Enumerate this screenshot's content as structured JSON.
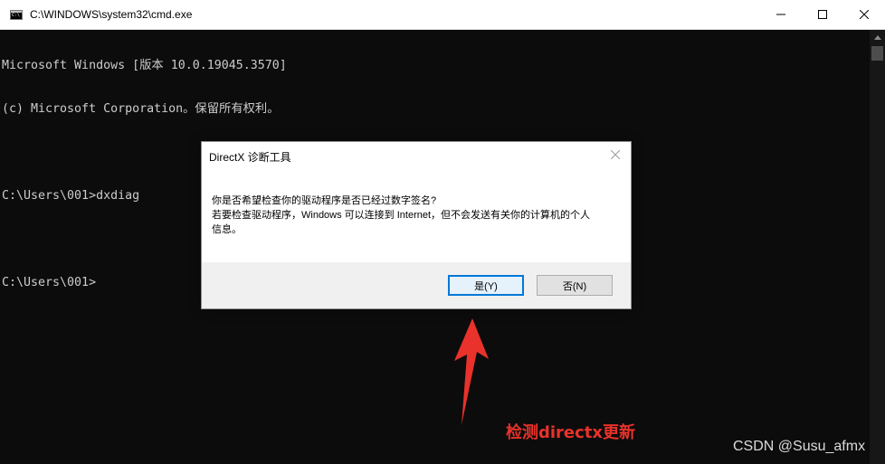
{
  "window": {
    "title": "C:\\WINDOWS\\system32\\cmd.exe",
    "icon": "cmd-icon",
    "controls": [
      "minimize-icon",
      "maximize-icon",
      "close-icon"
    ]
  },
  "console": {
    "lines": [
      "Microsoft Windows [版本 10.0.19045.3570]",
      "(c) Microsoft Corporation。保留所有权利。",
      "",
      "C:\\Users\\001>dxdiag",
      "",
      "C:\\Users\\001>"
    ]
  },
  "dialog": {
    "title": "DirectX 诊断工具",
    "message_lines": [
      "你是否希望检查你的驱动程序是否已经过数字签名?",
      "若要检查驱动程序，Windows 可以连接到 Internet，但不会发送有关你的计算机的个人",
      "信息。"
    ],
    "yes_label": "是(Y)",
    "no_label": "否(N)"
  },
  "annotation": {
    "text": "检测directx更新",
    "color": "#e8322b"
  },
  "watermark": {
    "text": "CSDN @Susu_afmx"
  },
  "colors": {
    "console_bg": "#0c0c0c",
    "console_text": "#cccccc",
    "focus_accent": "#0078d7"
  }
}
